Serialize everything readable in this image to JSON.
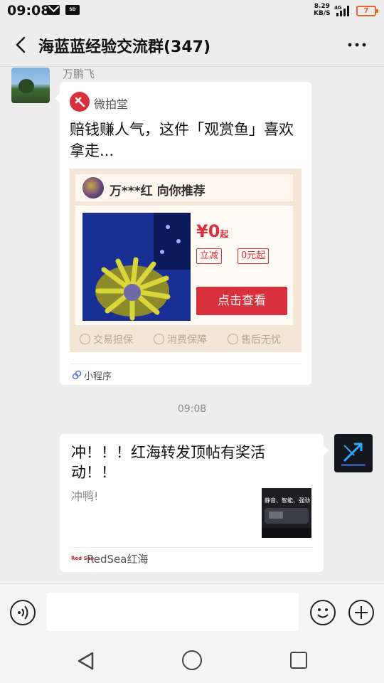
{
  "status_bar": {
    "time": "09:08",
    "net_speed_value": "8.29",
    "net_speed_unit": "KB/S",
    "network": "4G",
    "battery": "7"
  },
  "header": {
    "title": "海蓝蓝经验交流群(347)"
  },
  "messages": [
    {
      "sender": "万鹏飞",
      "mini_program": {
        "name": "微拍堂",
        "title": "赔钱赚人气，这件「观赏鱼」喜欢拿走...",
        "recommender": "万***红 向你推荐",
        "price": "¥0",
        "price_suffix": "起",
        "tag_discount": "立减",
        "tag_start": "0元起",
        "cta": "点击查看",
        "guarantees": [
          "交易担保",
          "消费保障",
          "售后无忧"
        ],
        "footer_label": "小程序"
      }
    },
    {
      "timestamp": "09:08"
    },
    {
      "link_card": {
        "title": "冲！！！红海转发顶帖有奖活动！！",
        "description": "冲鸭!",
        "thumb_text": "静音、智能、强劲",
        "source_name": "RedSea红海",
        "source_logo_text": "Red Sea"
      }
    }
  ],
  "input": {
    "placeholder": ""
  },
  "colors": {
    "accent": "#d9303d",
    "background": "#ededed"
  }
}
